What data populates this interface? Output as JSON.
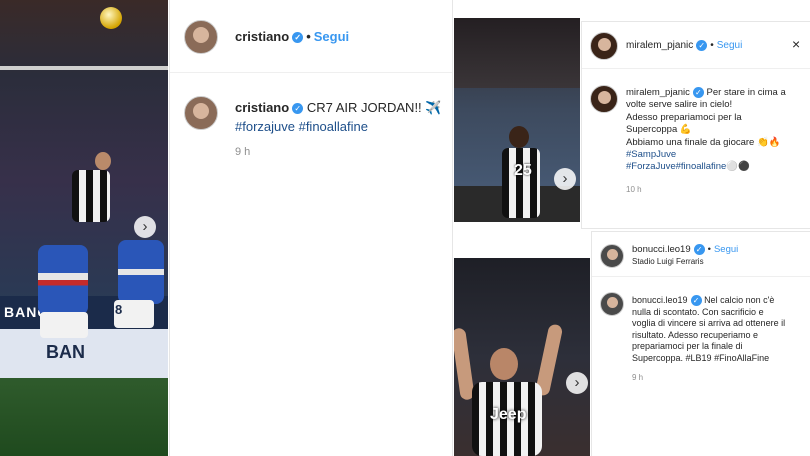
{
  "post1": {
    "username": "cristiano",
    "follow": "Segui",
    "caption_user": "cristiano",
    "caption_text": "CR7 AIR JORDAN!!",
    "caption_emoji": "✈️",
    "hashtags": "#forzajuve #finoallafine",
    "time": "9 h",
    "ad_banner_1": "BANCA",
    "ad_banner_2": "BAN",
    "player_number": "8"
  },
  "post2": {
    "username": "miralem_pjanic",
    "follow": "Segui",
    "caption_user": "miralem_pjanic",
    "caption_lines": [
      "Per stare in cima a",
      "volte serve salire in cielo!",
      "Adesso prepariamoci per la",
      "Supercoppa 💪",
      "Abbiamo una finale da giocare 👏🔥",
      "#SampJuve",
      "#ForzaJuve#finoallafine⚪⚫"
    ],
    "time": "10 h",
    "jersey_number": "25"
  },
  "post3": {
    "username": "bonucci.leo19",
    "follow": "Segui",
    "location": "Stadio Luigi Ferraris",
    "caption_user": "bonucci.leo19",
    "caption_lines": [
      "Nel calcio non c'è",
      "nulla di scontato. Con sacrificio e",
      "voglia di vincere si arriva ad ottenere il",
      "risultato. Adesso recuperiamo e",
      "prepariamoci per la finale di",
      "Supercoppa. #LB19 #FinoAllaFine"
    ],
    "time": "9 h",
    "sponsor": "Jeep"
  }
}
